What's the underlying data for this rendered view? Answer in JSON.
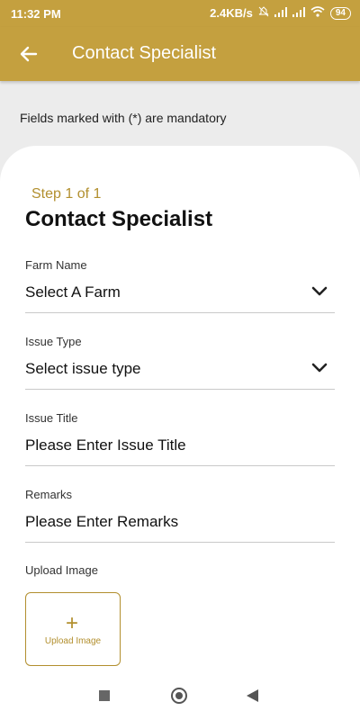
{
  "status_bar": {
    "time": "11:32 PM",
    "network_speed": "2.4KB/s",
    "battery": "94",
    "icons": [
      "mute-icon",
      "signal-icon",
      "signal-icon",
      "wifi-icon",
      "battery-icon"
    ]
  },
  "app_bar": {
    "title": "Contact Specialist",
    "back_icon": "arrow-left-icon",
    "background_color": "#c4a03f"
  },
  "mandatory_note": "Fields marked with (*) are mandatory",
  "form": {
    "step": "Step 1 of 1",
    "heading": "Contact Specialist",
    "fields": [
      {
        "label": "Farm Name",
        "value": "Select A Farm",
        "type": "dropdown"
      },
      {
        "label": "Issue Type",
        "value": "Select issue type",
        "type": "dropdown"
      },
      {
        "label": "Issue Title",
        "placeholder": "Please Enter Issue Title",
        "type": "text"
      },
      {
        "label": "Remarks",
        "placeholder": "Please Enter Remarks",
        "type": "text"
      }
    ],
    "upload": {
      "label": "Upload Image",
      "button_text": "Upload Image",
      "icon": "plus-icon"
    },
    "accent_color": "#b28f2e"
  },
  "nav_bar": {
    "icons": [
      "recents-square-icon",
      "home-circle-icon",
      "back-triangle-icon"
    ]
  }
}
